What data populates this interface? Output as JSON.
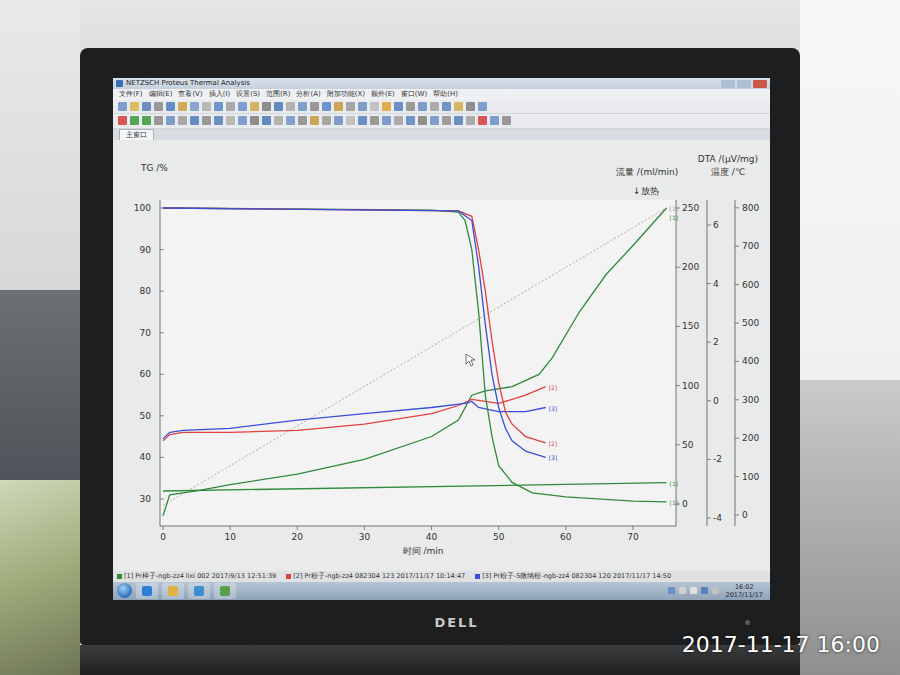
{
  "window": {
    "title": "NETZSCH Proteus Thermal Analysis"
  },
  "menu": [
    "文件(F)",
    "编辑(E)",
    "查看(V)",
    "插入(I)",
    "设置(S)",
    "范围(R)",
    "分析(A)",
    "附加功能(X)",
    "额外(E)",
    "窗口(W)",
    "帮助(H)"
  ],
  "tabs": [
    {
      "label": "主窗口",
      "selected": true
    }
  ],
  "chart": {
    "exo_marker": "↓放热",
    "axes": {
      "tg": {
        "title": "TG /%",
        "ticks": [
          "100",
          "90",
          "80",
          "70",
          "60",
          "50",
          "40",
          "30"
        ]
      },
      "dta": {
        "title": "DTA /(μV/mg)",
        "ticks": [
          "6",
          "4",
          "2",
          "0",
          "-2",
          "-4"
        ]
      },
      "flow": {
        "title": "流量 /(ml/min)",
        "ticks": [
          "250",
          "200",
          "150",
          "100",
          "50",
          "0"
        ]
      },
      "temperature": {
        "title": "温度 /℃",
        "ticks": [
          "800",
          "700",
          "600",
          "500",
          "400",
          "300",
          "200",
          "100",
          "0"
        ]
      },
      "time": {
        "title": "时间 /min",
        "ticks": [
          "0",
          "10",
          "20",
          "30",
          "40",
          "50",
          "60",
          "70"
        ]
      }
    },
    "series": [
      {
        "label": "[1]",
        "axis": "temperature",
        "color": "#b98a8f",
        "dashed": true,
        "t": [
          0,
          75
        ],
        "values": [
          25,
          800
        ]
      },
      {
        "label": "[1]",
        "axis": "flow",
        "color": "#2f8a3c",
        "dashed": false,
        "t": [
          0,
          75
        ],
        "values": [
          11,
          18
        ]
      },
      {
        "label": "[1]",
        "axis": "dta",
        "color": "#2f8a3c",
        "dashed": false,
        "t": [
          0,
          1,
          5,
          10,
          20,
          30,
          40,
          44,
          46,
          48,
          52,
          56,
          58,
          62,
          66,
          70,
          75
        ],
        "values": [
          -3.92,
          -3.21,
          -3.07,
          -2.86,
          -2.5,
          -2.0,
          -1.22,
          -0.66,
          0.19,
          0.34,
          0.48,
          0.9,
          1.47,
          3.03,
          4.31,
          5.3,
          6.58
        ]
      },
      {
        "label": "[2]",
        "axis": "dta",
        "color": "#e0403f",
        "dashed": false,
        "t": [
          0,
          1,
          3,
          10,
          20,
          30,
          40,
          44,
          46,
          48,
          50,
          54,
          57
        ],
        "values": [
          -1.37,
          -1.15,
          -1.08,
          -1.08,
          -1.01,
          -0.8,
          -0.44,
          -0.16,
          0.05,
          -0.02,
          -0.09,
          0.19,
          0.48
        ]
      },
      {
        "label": "[3]",
        "axis": "dta",
        "color": "#3a4fd8",
        "dashed": false,
        "t": [
          0,
          1,
          3,
          10,
          20,
          30,
          40,
          45,
          46,
          47,
          50,
          54,
          57
        ],
        "values": [
          -1.3,
          -1.08,
          -1.01,
          -0.94,
          -0.66,
          -0.44,
          -0.23,
          -0.09,
          -0.02,
          -0.23,
          -0.37,
          -0.37,
          -0.23
        ]
      },
      {
        "label": "[1]",
        "axis": "tg",
        "color": "#2f8a3c",
        "dashed": false,
        "t": [
          0,
          40,
          44,
          45,
          46,
          47,
          48,
          49,
          50,
          52,
          55,
          60,
          70,
          75
        ],
        "values": [
          100,
          99.5,
          99,
          97,
          90,
          75,
          55,
          45,
          38,
          34,
          31.5,
          30.5,
          29.5,
          29.3
        ]
      },
      {
        "label": "[2]",
        "axis": "tg",
        "color": "#e0403f",
        "dashed": false,
        "t": [
          0,
          44,
          46,
          47,
          48,
          49,
          50,
          51,
          52,
          54,
          57
        ],
        "values": [
          100,
          99.3,
          98,
          90,
          80,
          68,
          58,
          51,
          48,
          45,
          43.5
        ]
      },
      {
        "label": "[3]",
        "axis": "tg",
        "color": "#3a4fd8",
        "dashed": false,
        "t": [
          0,
          44,
          46,
          47,
          48,
          49,
          50,
          51,
          52,
          54,
          57
        ],
        "values": [
          100,
          99.3,
          97,
          86,
          72,
          60,
          52,
          47,
          44,
          41.5,
          40
        ]
      }
    ]
  },
  "file_rows": [
    {
      "text": "[1] Pr样子-ngb-zz4   lixi   002   2017/9/13 12:51:39",
      "color": "#2f8a3c"
    },
    {
      "text": "[2] Pr粉子-ngb-zz4   082304   123   2017/11/17 10:14:47",
      "color": "#e0403f"
    },
    {
      "text": "[3] Pr粉子-5微纳粉-ngb-zz4   082304   120   2017/11/17 14:50",
      "color": "#3a4fd8"
    }
  ],
  "taskbar": {
    "time": "16:02",
    "date": "2017/11/17"
  },
  "monitor": {
    "brand": "DELL"
  },
  "photo_timestamp": "2017-11-17 16:00"
}
